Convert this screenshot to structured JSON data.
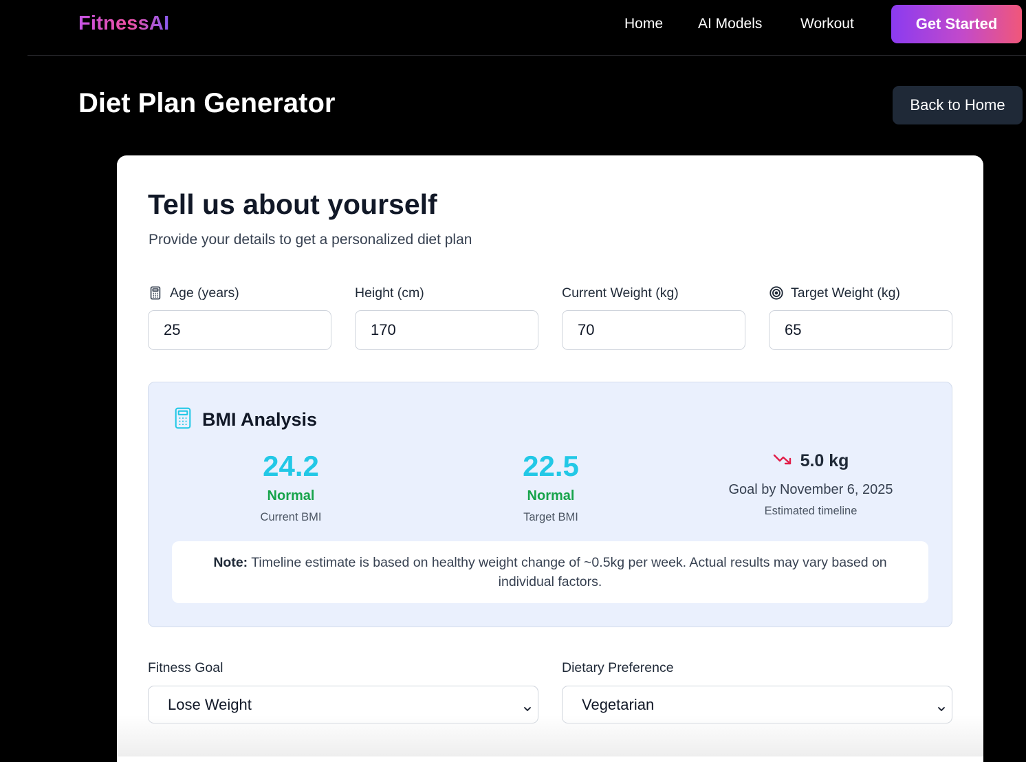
{
  "nav": {
    "logo": "FitnessAI",
    "links": [
      "Home",
      "AI Models",
      "Workout"
    ],
    "cta": "Get Started"
  },
  "header": {
    "title": "Diet Plan Generator",
    "back_button": "Back to Home"
  },
  "form": {
    "title": "Tell us about yourself",
    "subtitle": "Provide your details to get a personalized diet plan",
    "fields": [
      {
        "label": "Age (years)",
        "value": "25",
        "icon": "calculator-icon"
      },
      {
        "label": "Height (cm)",
        "value": "170"
      },
      {
        "label": "Current Weight (kg)",
        "value": "70"
      },
      {
        "label": "Target Weight (kg)",
        "value": "65",
        "icon": "target-icon"
      }
    ]
  },
  "bmi": {
    "title": "BMI Analysis",
    "icon": "calculator-icon",
    "current": {
      "value": "24.2",
      "category": "Normal",
      "label": "Current BMI"
    },
    "target": {
      "value": "22.5",
      "category": "Normal",
      "label": "Target BMI"
    },
    "change": {
      "value": "5.0 kg",
      "goal": "Goal by November 6, 2025",
      "label": "Estimated timeline",
      "icon": "trending-down-icon"
    },
    "note_label": "Note:",
    "note_text": " Timeline estimate is based on healthy weight change of ~0.5kg per week. Actual results may vary based on individual factors."
  },
  "selects": [
    {
      "label": "Fitness Goal",
      "value": "Lose Weight"
    },
    {
      "label": "Dietary Preference",
      "value": "Vegetarian"
    }
  ],
  "colors": {
    "bmi_value": "#22c8e6",
    "bmi_category": "#16a34a",
    "trend_down": "#e11d48",
    "panel_bg": "#eaf0fd"
  }
}
